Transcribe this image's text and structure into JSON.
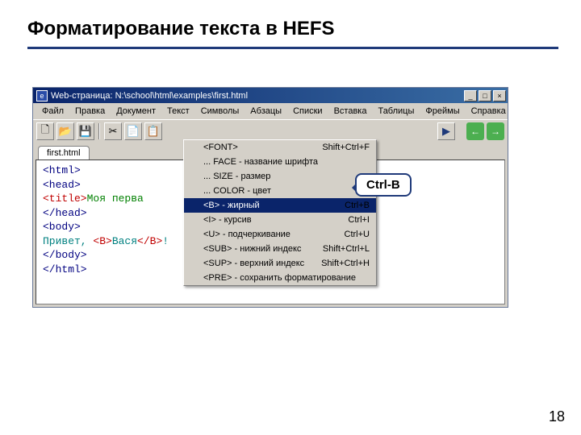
{
  "slide": {
    "title": "Форматирование текста в HEFS",
    "page_number": "18"
  },
  "window": {
    "title": "Web-страница: N:\\school\\html\\examples\\first.html",
    "win_buttons": {
      "min": "_",
      "max": "□",
      "close": "×"
    }
  },
  "menu": [
    "Файл",
    "Правка",
    "Документ",
    "Текст",
    "Символы",
    "Абзацы",
    "Списки",
    "Вставка",
    "Таблицы",
    "Фреймы",
    "Справка"
  ],
  "toolbar_icons": {
    "new": "🗋",
    "open": "📂",
    "save": "💾",
    "cut": "✂",
    "copy": "📄",
    "paste": "📋",
    "play": "▶",
    "back": "←",
    "fwd": "→"
  },
  "tab": {
    "name": "first.html"
  },
  "code": {
    "l1": "<html>",
    "l2": "<head>",
    "l3a": "  ",
    "l3b": "<title>",
    "l3c": "Моя перва",
    "l4": "</head>",
    "l5": "<body>",
    "l6a": "Привет, ",
    "l6b": "<B>",
    "l6c": "Вася",
    "l6d": "</B>",
    "l6e": "!",
    "l7": "</body>",
    "l8": "</html>"
  },
  "dropdown": [
    {
      "label": "<FONT>",
      "shortcut": "Shift+Ctrl+F",
      "sel": false
    },
    {
      "label": "... FACE - название шрифта",
      "shortcut": "",
      "sel": false
    },
    {
      "label": "... SIZE - размер",
      "shortcut": "",
      "sel": false
    },
    {
      "label": "... COLOR - цвет",
      "shortcut": "",
      "sel": false
    },
    {
      "label": "<B> - жирный",
      "shortcut": "Ctrl+B",
      "sel": true
    },
    {
      "label": "<I> - курсив",
      "shortcut": "Ctrl+I",
      "sel": false
    },
    {
      "label": "<U> - подчеркивание",
      "shortcut": "Ctrl+U",
      "sel": false
    },
    {
      "label": "<SUB> - нижний индекс",
      "shortcut": "Shift+Ctrl+L",
      "sel": false
    },
    {
      "label": "<SUP> - верхний индекс",
      "shortcut": "Shift+Ctrl+H",
      "sel": false
    },
    {
      "label": "<PRE> - сохранить форматирование",
      "shortcut": "",
      "sel": false
    }
  ],
  "callout": {
    "text": "Ctrl-B"
  }
}
